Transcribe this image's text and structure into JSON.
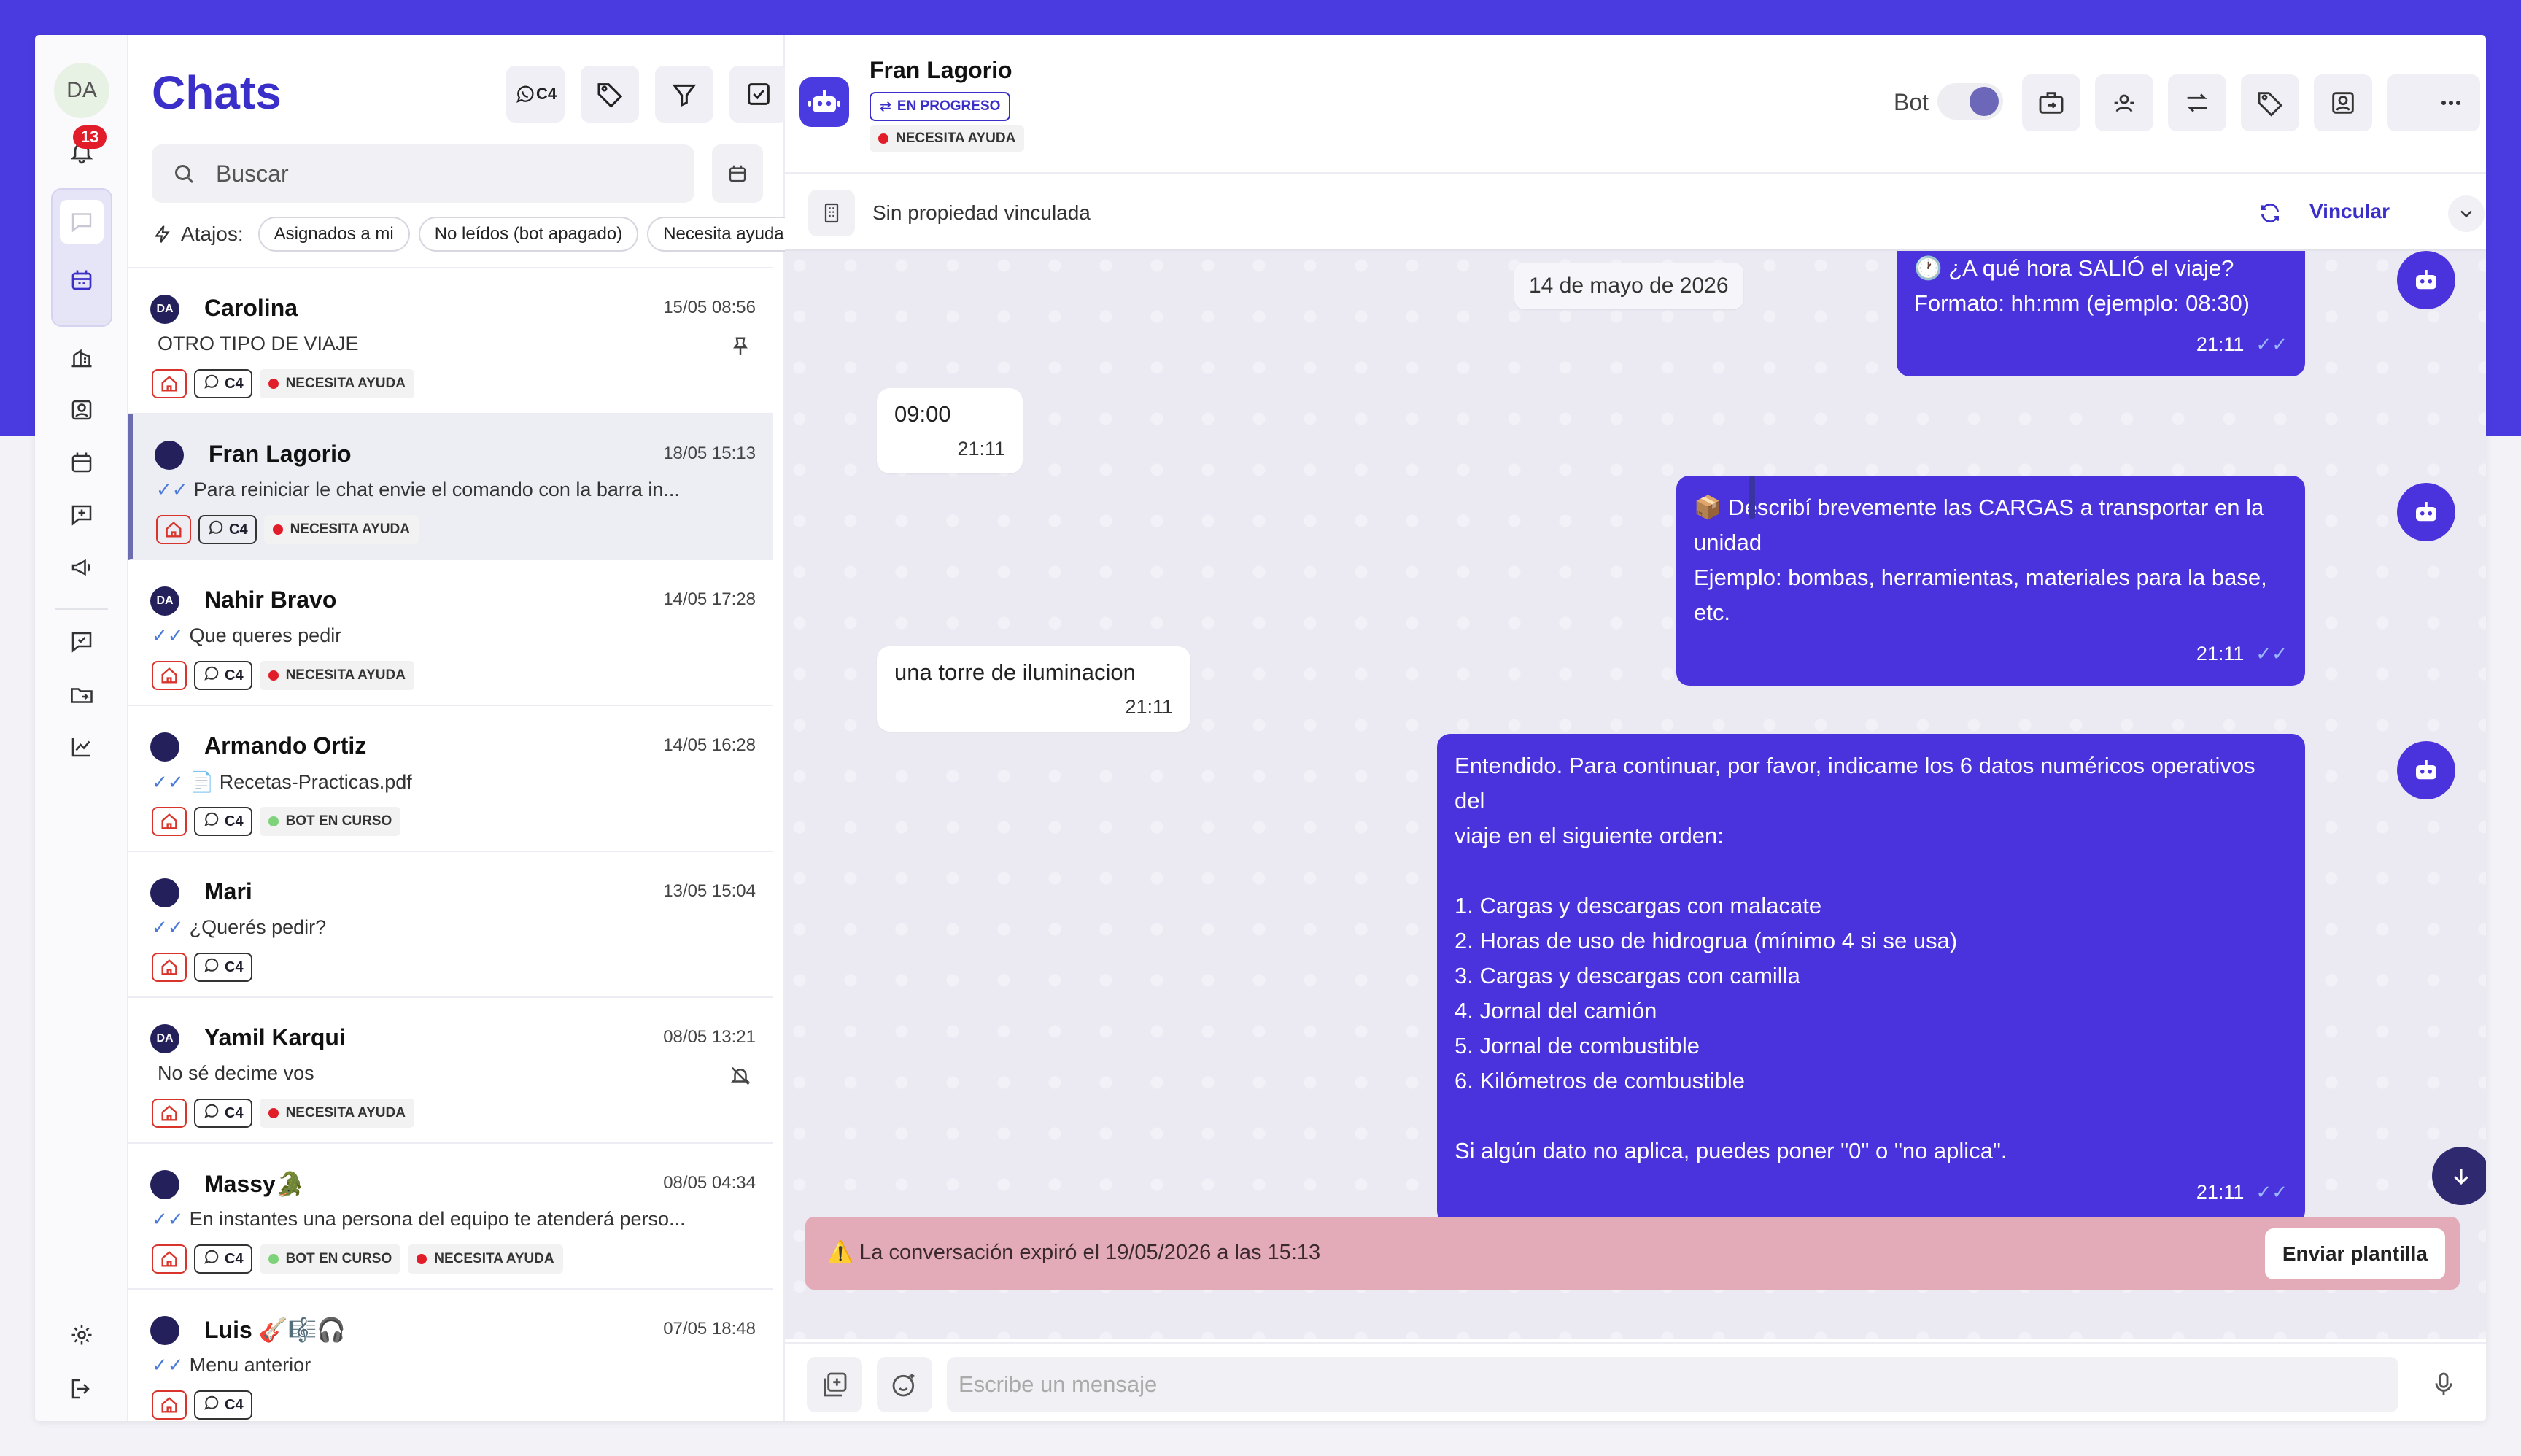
{
  "rail": {
    "avatar_initials": "DA",
    "notifications_count": "13"
  },
  "list": {
    "title": "Chats",
    "channel_filter_label": "C4",
    "search_placeholder": "Buscar",
    "shortcuts_label": "Atajos:",
    "shortcuts": [
      "Asignados a mi",
      "No leídos (bot apagado)",
      "Necesita ayuda"
    ],
    "chats": [
      {
        "name": "Carolina",
        "initials": "DA",
        "time": "15/05 08:56",
        "preview": "OTRO TIPO DE VIAJE",
        "ticks": "",
        "channel": "C4",
        "statuses": [
          {
            "label": "NECESITA AYUDA",
            "color": "#e11d2a"
          }
        ],
        "pinned": true,
        "muted": false
      },
      {
        "name": "Fran Lagorio",
        "initials": "",
        "time": "18/05 15:13",
        "preview": "Para reiniciar le chat envie el comando con la barra in...",
        "ticks": "✓✓",
        "channel": "C4",
        "statuses": [
          {
            "label": "NECESITA AYUDA",
            "color": "#e11d2a"
          }
        ],
        "pinned": false,
        "muted": false
      },
      {
        "name": "Nahir Bravo",
        "initials": "DA",
        "time": "14/05 17:28",
        "preview": "Que queres pedir",
        "ticks": "✓✓",
        "channel": "C4",
        "statuses": [
          {
            "label": "NECESITA AYUDA",
            "color": "#e11d2a"
          }
        ],
        "pinned": false,
        "muted": false
      },
      {
        "name": "Armando Ortiz",
        "initials": "",
        "time": "14/05 16:28",
        "preview": "📄 Recetas-Practicas.pdf",
        "ticks": "✓✓",
        "channel": "C4",
        "statuses": [
          {
            "label": "BOT EN CURSO",
            "color": "#7ed37a"
          }
        ],
        "pinned": false,
        "muted": false
      },
      {
        "name": "Mari",
        "initials": "",
        "time": "13/05 15:04",
        "preview": "¿Querés pedir?",
        "ticks": "✓✓",
        "channel": "C4",
        "statuses": [],
        "pinned": false,
        "muted": false
      },
      {
        "name": "Yamil Karqui",
        "initials": "DA",
        "time": "08/05 13:21",
        "preview": "No sé decime vos",
        "ticks": "",
        "channel": "C4",
        "statuses": [
          {
            "label": "NECESITA AYUDA",
            "color": "#e11d2a"
          }
        ],
        "pinned": false,
        "muted": true
      },
      {
        "name": "Massy🐊",
        "initials": "",
        "time": "08/05 04:34",
        "preview": "En instantes una persona del equipo te atenderá perso...",
        "ticks": "✓✓",
        "channel": "C4",
        "statuses": [
          {
            "label": "BOT EN CURSO",
            "color": "#7ed37a"
          },
          {
            "label": "NECESITA AYUDA",
            "color": "#e11d2a"
          }
        ],
        "pinned": false,
        "muted": false
      },
      {
        "name": "Luis 🎸🎼🎧",
        "initials": "",
        "time": "07/05 18:48",
        "preview": "Menu anterior",
        "ticks": "✓✓",
        "channel": "C4",
        "statuses": [],
        "pinned": false,
        "muted": false
      }
    ]
  },
  "chat": {
    "contact_name": "Fran Lagorio",
    "status": "EN PROGRESO",
    "help_tag": "NECESITA AYUDA",
    "bot_label": "Bot",
    "property_text": "Sin propiedad vinculada",
    "link_label": "Vincular",
    "date_separator": "14 de mayo de 2026",
    "messages": [
      {
        "dir": "out",
        "text": "🕐 ¿A qué hora SALIÓ el viaje?\nFormato: hh:mm (ejemplo: 08:30)",
        "time": "21:11"
      },
      {
        "dir": "in",
        "text": "09:00",
        "time": "21:11"
      },
      {
        "dir": "out",
        "text": "📦 Describí brevemente las CARGAS a transportar en la unidad\nEjemplo: bombas, herramientas, materiales para la base, etc.",
        "time": "21:11"
      },
      {
        "dir": "in",
        "text": "una torre de iluminacion",
        "time": "21:11"
      },
      {
        "dir": "out",
        "text": "Entendido. Para continuar, por favor, indicame los 6 datos numéricos operativos del\nviaje en el siguiente orden:\n\n1. Cargas y descargas con malacate\n2. Horas de uso de hidrogrua (mínimo 4 si se usa)\n3. Cargas y descargas con camilla\n4. Jornal del camión\n5. Jornal de combustible\n6. Kilómetros de combustible\n\nSi algún dato no aplica, puedes poner \"0\" o \"no aplica\".",
        "time": "21:11"
      }
    ],
    "expired_text": "⚠️ La conversación expiró el 19/05/2026 a las 15:13",
    "send_template_label": "Enviar plantilla",
    "composer_placeholder": "Escribe un mensaje"
  },
  "colors": {
    "brand": "#4a3be0",
    "outgoing_bubble": "#4a33dd",
    "help_dot": "#e11d2a",
    "bot_running_dot": "#7ed37a",
    "expired_banner": "#e3aab8"
  }
}
